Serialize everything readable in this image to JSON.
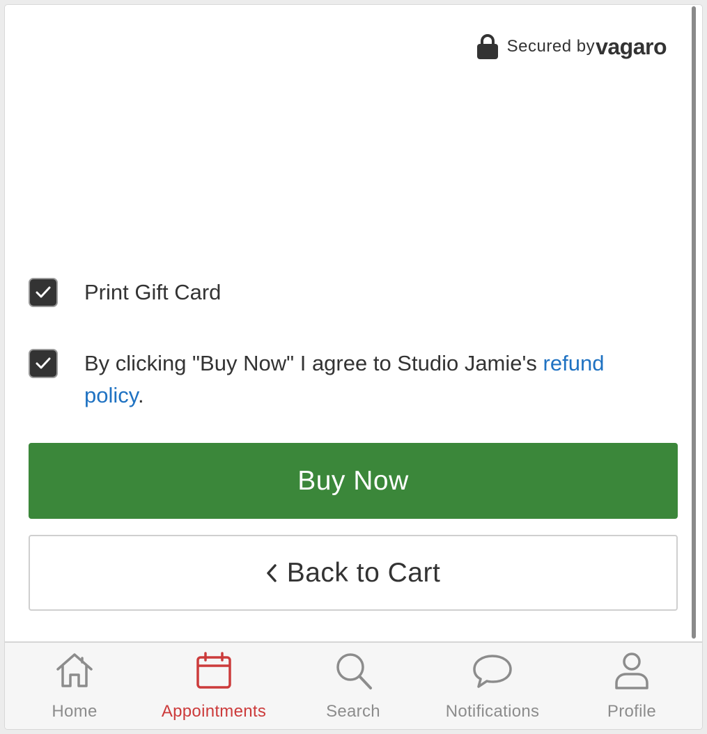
{
  "header": {
    "secured_text": "Secured by",
    "brand": "vagaro"
  },
  "options": {
    "print_gift_card": {
      "label": "Print Gift Card",
      "checked": true
    },
    "agreement": {
      "text_before": "By clicking \"Buy Now\" I agree to Studio Jamie's ",
      "link_text": "refund policy",
      "text_after": ".",
      "checked": true
    }
  },
  "actions": {
    "buy_now": "Buy Now",
    "back_to_cart": "Back to Cart"
  },
  "tabbar": {
    "items": [
      {
        "label": "Home",
        "icon": "home-icon",
        "active": false
      },
      {
        "label": "Appointments",
        "icon": "calendar-icon",
        "active": true
      },
      {
        "label": "Search",
        "icon": "search-icon",
        "active": false
      },
      {
        "label": "Notifications",
        "icon": "chat-bubble-icon",
        "active": false
      },
      {
        "label": "Profile",
        "icon": "user-icon",
        "active": false
      }
    ]
  },
  "colors": {
    "primary_green": "#3b873a",
    "link_blue": "#1f72c2",
    "active_red": "#cc3b3b",
    "text_dark": "#333333",
    "tab_inactive": "#8c8c8c"
  }
}
